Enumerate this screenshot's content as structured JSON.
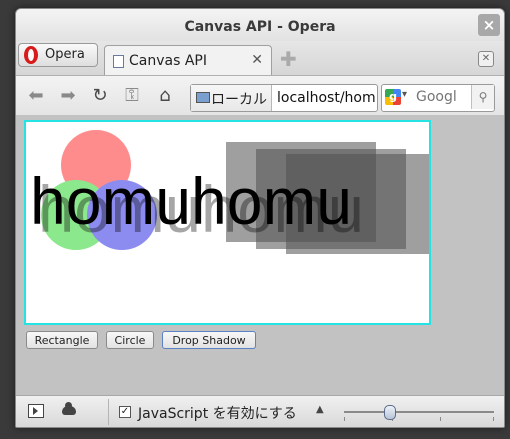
{
  "window": {
    "title": "Canvas API - Opera",
    "close_glyph": "×"
  },
  "tabs": {
    "menu_label": "Opera",
    "active_tab": "Canvas API",
    "tab_close_glyph": "✕",
    "new_tab_glyph": "✚",
    "trash_glyph": "✕"
  },
  "toolbar": {
    "back_glyph": "⬅",
    "forward_glyph": "➡",
    "reload_glyph": "↻",
    "key_glyph": "⚿",
    "home_glyph": "⌂",
    "address_badge": "ローカル",
    "address": "localhost/hom",
    "search_placeholder": "Googl",
    "google_letter": "g",
    "search_drop_glyph": "▾",
    "search_go_glyph": "⚲"
  },
  "demo": {
    "text": "homuhomu",
    "buttons": [
      "Rectangle",
      "Circle",
      "Drop Shadow"
    ],
    "colors": {
      "canvas_border": "#26e3e3",
      "circle_red": "#ff8c8c",
      "circle_green": "#8ce88c",
      "circle_blue": "#8c8cf0",
      "rect_gray": "#505050"
    }
  },
  "status": {
    "js_checked_glyph": "✓",
    "js_label": "JavaScript を有効にする",
    "zoom_arrow_glyph": "▲",
    "zoom_level": 0.3
  },
  "icons": [
    "close-icon",
    "opera-logo-icon",
    "document-icon",
    "plus-icon",
    "trash-icon",
    "back-icon",
    "forward-icon",
    "reload-icon",
    "key-icon",
    "home-icon",
    "monitor-icon",
    "google-icon",
    "search-icon",
    "panel-icon",
    "cloud-icon",
    "checkbox-icon"
  ]
}
